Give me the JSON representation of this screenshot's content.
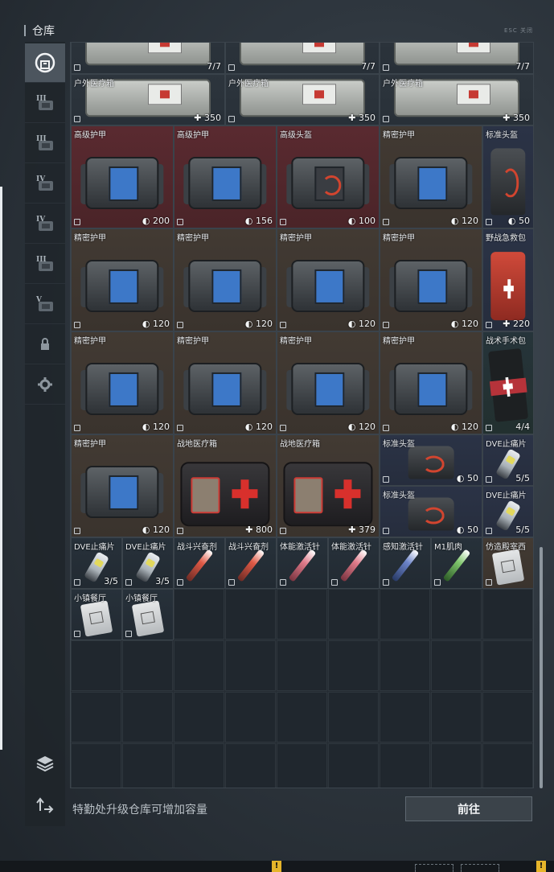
{
  "window": {
    "title": "仓库",
    "corner_label": "ESC 关闭"
  },
  "sidebar": {
    "tabs": [
      {
        "icon": "warehouse-icon"
      },
      {
        "icon": "storage-tab-iii-icon",
        "label": "III"
      },
      {
        "icon": "storage-tab-iii-b-icon",
        "label": "III"
      },
      {
        "icon": "storage-tab-iv-icon",
        "label": "IV"
      },
      {
        "icon": "storage-tab-iv-b-icon",
        "label": "IV"
      },
      {
        "icon": "storage-tab-iii-c-icon",
        "label": "III"
      },
      {
        "icon": "storage-tab-v-icon",
        "label": "V"
      },
      {
        "icon": "lock-icon"
      },
      {
        "icon": "gear-icon"
      }
    ],
    "bottom_icons": [
      "layers-icon",
      "sort-icon"
    ]
  },
  "inventory": [
    {
      "name": "",
      "count": "7/7",
      "col": 0,
      "row": 0,
      "w": 3,
      "h": 1,
      "kind": "outdoor",
      "tone": "gray"
    },
    {
      "name": "",
      "count": "7/7",
      "col": 3,
      "row": 0,
      "w": 3,
      "h": 1,
      "kind": "outdoor",
      "tone": "gray"
    },
    {
      "name": "",
      "count": "7/7",
      "col": 6,
      "row": 0,
      "w": 3,
      "h": 1,
      "kind": "outdoor",
      "tone": "gray"
    },
    {
      "name": "户外医疗箱",
      "count": "✚ 350",
      "col": 0,
      "row": 1,
      "w": 3,
      "h": 1,
      "kind": "outdoor",
      "tone": "gray"
    },
    {
      "name": "户外医疗箱",
      "count": "✚ 350",
      "col": 3,
      "row": 1,
      "w": 3,
      "h": 1,
      "kind": "outdoor",
      "tone": "gray"
    },
    {
      "name": "户外医疗箱",
      "count": "✚ 350",
      "col": 6,
      "row": 1,
      "w": 3,
      "h": 1,
      "kind": "outdoor",
      "tone": "gray"
    },
    {
      "name": "高级护甲",
      "count": "◐ 200",
      "col": 0,
      "row": 2,
      "w": 2,
      "h": 2,
      "kind": "vest",
      "tone": "red"
    },
    {
      "name": "高级护甲",
      "count": "◐ 156",
      "col": 2,
      "row": 2,
      "w": 2,
      "h": 2,
      "kind": "vest",
      "tone": "red"
    },
    {
      "name": "高级头盔",
      "count": "◐ 100",
      "col": 4,
      "row": 2,
      "w": 2,
      "h": 2,
      "kind": "vest-red",
      "tone": "red"
    },
    {
      "name": "精密护甲",
      "count": "◐ 120",
      "col": 6,
      "row": 2,
      "w": 2,
      "h": 2,
      "kind": "vest",
      "tone": "brown"
    },
    {
      "name": "标准头盔",
      "count": "◐ 50",
      "col": 8,
      "row": 2,
      "w": 1,
      "h": 2,
      "kind": "helmet",
      "tone": "blue"
    },
    {
      "name": "精密护甲",
      "count": "◐ 120",
      "col": 0,
      "row": 4,
      "w": 2,
      "h": 2,
      "kind": "vest",
      "tone": "brown"
    },
    {
      "name": "精密护甲",
      "count": "◐ 120",
      "col": 2,
      "row": 4,
      "w": 2,
      "h": 2,
      "kind": "vest",
      "tone": "brown"
    },
    {
      "name": "精密护甲",
      "count": "◐ 120",
      "col": 4,
      "row": 4,
      "w": 2,
      "h": 2,
      "kind": "vest",
      "tone": "brown"
    },
    {
      "name": "精密护甲",
      "count": "◐ 120",
      "col": 6,
      "row": 4,
      "w": 2,
      "h": 2,
      "kind": "vest",
      "tone": "brown"
    },
    {
      "name": "野战急救包",
      "count": "✚ 220",
      "col": 8,
      "row": 4,
      "w": 1,
      "h": 2,
      "kind": "redkit",
      "tone": "blue"
    },
    {
      "name": "精密护甲",
      "count": "◐ 120",
      "col": 0,
      "row": 6,
      "w": 2,
      "h": 2,
      "kind": "vest",
      "tone": "brown"
    },
    {
      "name": "精密护甲",
      "count": "◐ 120",
      "col": 2,
      "row": 6,
      "w": 2,
      "h": 2,
      "kind": "vest",
      "tone": "brown"
    },
    {
      "name": "精密护甲",
      "count": "◐ 120",
      "col": 4,
      "row": 6,
      "w": 2,
      "h": 2,
      "kind": "vest",
      "tone": "brown"
    },
    {
      "name": "精密护甲",
      "count": "◐ 120",
      "col": 6,
      "row": 6,
      "w": 2,
      "h": 2,
      "kind": "vest",
      "tone": "brown"
    },
    {
      "name": "战术手术包",
      "count": "4/4",
      "col": 8,
      "row": 6,
      "w": 1,
      "h": 2,
      "kind": "pouch",
      "tone": "teal"
    },
    {
      "name": "精密护甲",
      "count": "◐ 120",
      "col": 0,
      "row": 8,
      "w": 2,
      "h": 2,
      "kind": "vest",
      "tone": "brown"
    },
    {
      "name": "战地医疗箱",
      "count": "✚ 800",
      "col": 2,
      "row": 8,
      "w": 2,
      "h": 2,
      "kind": "kit",
      "tone": "brown"
    },
    {
      "name": "战地医疗箱",
      "count": "✚ 379",
      "col": 4,
      "row": 8,
      "w": 2,
      "h": 2,
      "kind": "kit",
      "tone": "brown"
    },
    {
      "name": "标准头盔",
      "count": "◐ 50",
      "col": 6,
      "row": 8,
      "w": 2,
      "h": 1,
      "kind": "helmet",
      "tone": "blue"
    },
    {
      "name": "DVE止痛片",
      "count": "5/5",
      "col": 8,
      "row": 8,
      "w": 1,
      "h": 1,
      "kind": "pill",
      "tone": "blue"
    },
    {
      "name": "标准头盔",
      "count": "◐ 50",
      "col": 6,
      "row": 9,
      "w": 2,
      "h": 1,
      "kind": "helmet",
      "tone": "blue"
    },
    {
      "name": "DVE止痛片",
      "count": "5/5",
      "col": 8,
      "row": 9,
      "w": 1,
      "h": 1,
      "kind": "pill",
      "tone": "blue"
    },
    {
      "name": "DVE止痛片",
      "count": "3/5",
      "col": 0,
      "row": 10,
      "w": 1,
      "h": 1,
      "kind": "pill",
      "tone": "dark"
    },
    {
      "name": "DVE止痛片",
      "count": "3/5",
      "col": 1,
      "row": 10,
      "w": 1,
      "h": 1,
      "kind": "pill",
      "tone": "dark"
    },
    {
      "name": "战斗兴奋剂",
      "count": "",
      "col": 2,
      "row": 10,
      "w": 1,
      "h": 1,
      "kind": "injector-red",
      "tone": "dark"
    },
    {
      "name": "战斗兴奋剂",
      "count": "",
      "col": 3,
      "row": 10,
      "w": 1,
      "h": 1,
      "kind": "injector-red",
      "tone": "dark"
    },
    {
      "name": "体能激活针",
      "count": "",
      "col": 4,
      "row": 10,
      "w": 1,
      "h": 1,
      "kind": "injector-pink",
      "tone": "dark"
    },
    {
      "name": "体能激活针",
      "count": "",
      "col": 5,
      "row": 10,
      "w": 1,
      "h": 1,
      "kind": "injector-pink",
      "tone": "dark"
    },
    {
      "name": "感知激活针",
      "count": "",
      "col": 6,
      "row": 10,
      "w": 1,
      "h": 1,
      "kind": "injector-blue",
      "tone": "dark"
    },
    {
      "name": "M1肌肉",
      "count": "",
      "col": 7,
      "row": 10,
      "w": 1,
      "h": 1,
      "kind": "injector-green",
      "tone": "dark"
    },
    {
      "name": "仿造殿宰西",
      "count": "",
      "col": 8,
      "row": 10,
      "w": 1,
      "h": 1,
      "kind": "bandage",
      "tone": "brown"
    },
    {
      "name": "小镇餐厅",
      "count": "",
      "col": 0,
      "row": 11,
      "w": 1,
      "h": 1,
      "kind": "bandage",
      "tone": "dark"
    },
    {
      "name": "小镇餐厅",
      "count": "",
      "col": 1,
      "row": 11,
      "w": 1,
      "h": 1,
      "kind": "bandage",
      "tone": "dark"
    }
  ],
  "footer": {
    "hint": "特勤处升级仓库可增加容量",
    "go_label": "前往"
  },
  "colors": {
    "accent_blue": "#3d78c8",
    "medical_red": "#d8302c",
    "panel": "#252c33"
  }
}
